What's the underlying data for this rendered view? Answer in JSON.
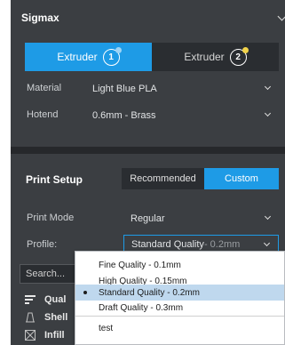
{
  "printer": {
    "name": "Sigmax"
  },
  "extruders": [
    {
      "label": "Extruder",
      "number": "1",
      "dot_color": "#9fd4f5"
    },
    {
      "label": "Extruder",
      "number": "2",
      "dot_color": "#f2d34a"
    }
  ],
  "material": {
    "label": "Material",
    "value": "Light Blue PLA"
  },
  "hotend": {
    "label": "Hotend",
    "value": "0.6mm - Brass"
  },
  "print_setup": {
    "title": "Print Setup",
    "tabs": [
      "Recommended",
      "Custom"
    ],
    "active_tab": "Custom"
  },
  "print_mode": {
    "label": "Print Mode",
    "value": "Regular"
  },
  "profile": {
    "label": "Profile:",
    "value": "Standard Quality",
    "suffix": " - 0.2mm"
  },
  "search": {
    "placeholder": "Search..."
  },
  "categories": [
    "Qual",
    "Shell",
    "Infill"
  ],
  "profile_options": [
    "Fine Quality - 0.1mm",
    "High Quality - 0.15mm",
    "Standard Quality - 0.2mm",
    "Draft Quality - 0.3mm"
  ],
  "selected_option_index": 2,
  "custom_profiles": [
    "test"
  ],
  "colors": {
    "accent": "#1e9be6",
    "panel": "#3b3e42",
    "dark": "#2a2d31"
  }
}
